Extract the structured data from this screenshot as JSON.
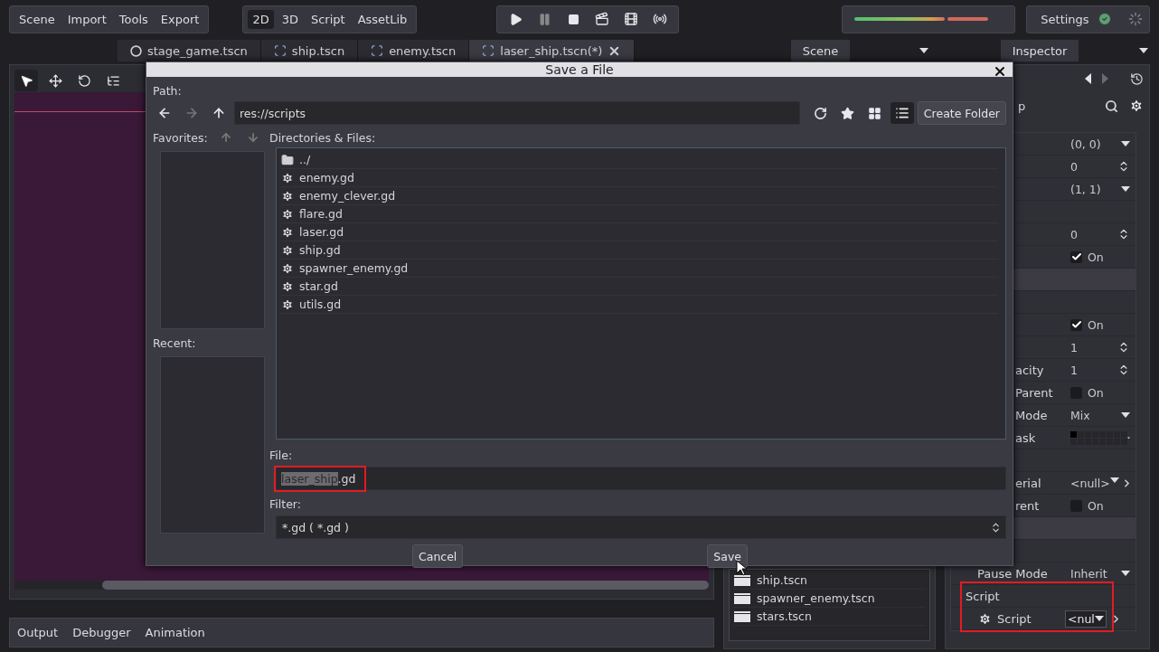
{
  "menu": [
    "Scene",
    "Import",
    "Tools",
    "Export"
  ],
  "workspaces": [
    {
      "label": "2D",
      "selected": true
    },
    {
      "label": "3D",
      "selected": false
    },
    {
      "label": "Script",
      "selected": false
    },
    {
      "label": "AssetLib",
      "selected": false
    }
  ],
  "settings": {
    "label": "Settings"
  },
  "scene_tabs": [
    {
      "label": "stage_game.tscn",
      "kind": "circle",
      "selected": false
    },
    {
      "label": "ship.tscn",
      "kind": "node2d",
      "selected": false
    },
    {
      "label": "enemy.tscn",
      "kind": "node2d",
      "selected": false
    },
    {
      "label": "laser_ship.tscn(*)",
      "kind": "node2d",
      "selected": true
    }
  ],
  "bottom_tabs": [
    "Output",
    "Debugger",
    "Animation"
  ],
  "scene_dock": {
    "tab": "Scene",
    "files": [
      "ship.tscn",
      "spawner_enemy.tscn",
      "stars.tscn"
    ]
  },
  "inspector": {
    "tab": "Inspector",
    "filter_fragment": "p",
    "rows": [
      {
        "kind": "dropdown",
        "value": "(0, 0)"
      },
      {
        "kind": "spin",
        "value": "0"
      },
      {
        "kind": "dropdown",
        "value": "(1, 1)"
      },
      {
        "kind": "blank"
      },
      {
        "kind": "spin",
        "value": "0"
      },
      {
        "kind": "check",
        "value": "On",
        "checked": true
      },
      {
        "kind": "section"
      },
      {
        "kind": "blank"
      },
      {
        "kind": "check",
        "value": "On",
        "checked": true
      },
      {
        "kind": "spin",
        "value": "1"
      },
      {
        "kind": "spin",
        "label": "acity",
        "value": "1"
      },
      {
        "kind": "check",
        "label": "Parent",
        "value": "On",
        "checked": false
      },
      {
        "kind": "dropdown",
        "label": "Mode",
        "value": "Mix"
      },
      {
        "kind": "mask",
        "label": "ask"
      },
      {
        "kind": "blank"
      },
      {
        "kind": "resource",
        "label": "erial",
        "value": "<null>"
      },
      {
        "kind": "check",
        "label": "rent",
        "value": "On",
        "checked": false
      },
      {
        "kind": "section"
      },
      {
        "kind": "blank"
      }
    ],
    "lower_rows": [
      {
        "kind": "dropdown",
        "label": "Pause Mode",
        "value": "Inherit"
      }
    ],
    "script_section": {
      "title": "Script",
      "highlighted": true,
      "label": "Script",
      "value": "<nul"
    }
  },
  "dialog": {
    "title": "Save a File",
    "path_label": "Path:",
    "path": "res://scripts",
    "create_folder": "Create Folder",
    "favorites_label": "Favorites:",
    "recent_label": "Recent:",
    "files_label": "Directories & Files:",
    "files": [
      {
        "name": "../",
        "kind": "folder"
      },
      {
        "name": "enemy.gd",
        "kind": "script"
      },
      {
        "name": "enemy_clever.gd",
        "kind": "script"
      },
      {
        "name": "flare.gd",
        "kind": "script"
      },
      {
        "name": "laser.gd",
        "kind": "script"
      },
      {
        "name": "ship.gd",
        "kind": "script"
      },
      {
        "name": "spawner_enemy.gd",
        "kind": "script"
      },
      {
        "name": "star.gd",
        "kind": "script"
      },
      {
        "name": "utils.gd",
        "kind": "script"
      }
    ],
    "file_label": "File:",
    "file": {
      "selected_text": "laser_ship",
      "rest": ".gd",
      "highlighted": true
    },
    "filter_label": "Filter:",
    "filter": "*.gd ( *.gd )",
    "cancel": "Cancel",
    "save": "Save"
  }
}
